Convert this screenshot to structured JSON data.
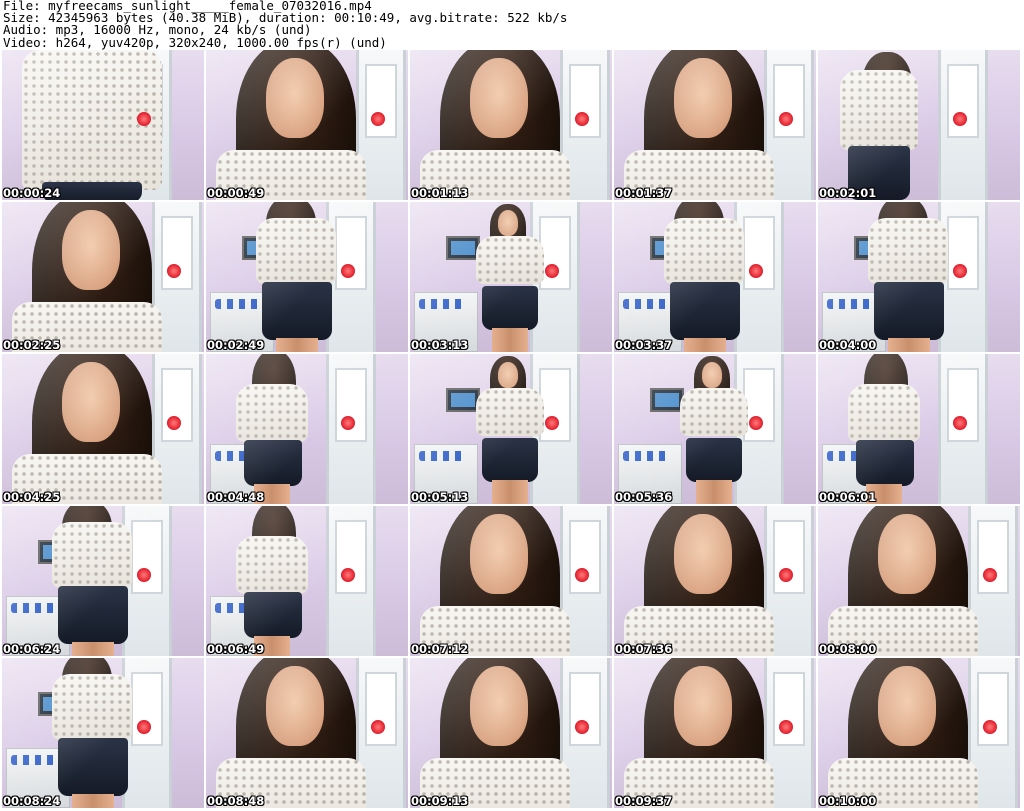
{
  "header": {
    "file_line": "File: myfreecams_sunlight_____female_07032016.mp4",
    "size_line": "Size: 42345963 bytes (40.38 MiB), duration: 00:10:49, avg.bitrate: 522 kb/s",
    "audio_line": "Audio: mp3, 16000 Hz, mono, 24 kb/s (und)",
    "video_line": "Video: h264, yuv420p, 320x240, 1000.00 fps(r) (und)"
  },
  "thumbnails": [
    {
      "timestamp": "00:00:24",
      "scene": "closeup-torso"
    },
    {
      "timestamp": "00:00:49",
      "scene": "face-closeup"
    },
    {
      "timestamp": "00:01:13",
      "scene": "face-closeup"
    },
    {
      "timestamp": "00:01:37",
      "scene": "face-closeup"
    },
    {
      "timestamp": "00:02:01",
      "scene": "arms-up"
    },
    {
      "timestamp": "00:02:25",
      "scene": "face-closeup"
    },
    {
      "timestamp": "00:02:49",
      "scene": "standing"
    },
    {
      "timestamp": "00:03:13",
      "scene": "full-body"
    },
    {
      "timestamp": "00:03:37",
      "scene": "standing"
    },
    {
      "timestamp": "00:04:00",
      "scene": "standing"
    },
    {
      "timestamp": "00:04:25",
      "scene": "face-closeup"
    },
    {
      "timestamp": "00:04:48",
      "scene": "back-view"
    },
    {
      "timestamp": "00:05:13",
      "scene": "full-body"
    },
    {
      "timestamp": "00:05:36",
      "scene": "full-body"
    },
    {
      "timestamp": "00:06:01",
      "scene": "back-view"
    },
    {
      "timestamp": "00:06:24",
      "scene": "standing"
    },
    {
      "timestamp": "00:06:49",
      "scene": "back-view"
    },
    {
      "timestamp": "00:07:12",
      "scene": "face-closeup"
    },
    {
      "timestamp": "00:07:36",
      "scene": "face-closeup"
    },
    {
      "timestamp": "00:08:00",
      "scene": "face-closeup"
    },
    {
      "timestamp": "00:08:24",
      "scene": "standing"
    },
    {
      "timestamp": "00:08:48",
      "scene": "face-closeup"
    },
    {
      "timestamp": "00:09:13",
      "scene": "face-closeup"
    },
    {
      "timestamp": "00:09:37",
      "scene": "face-closeup"
    },
    {
      "timestamp": "00:10:00",
      "scene": "face-closeup"
    }
  ],
  "colors": {
    "wall": "#d9c9e6",
    "sweater": "#f2efe8",
    "skirt": "#1c2333",
    "hair": "#24160d",
    "flower": "#e01b2a",
    "timestamp_text": "#ffffff"
  }
}
